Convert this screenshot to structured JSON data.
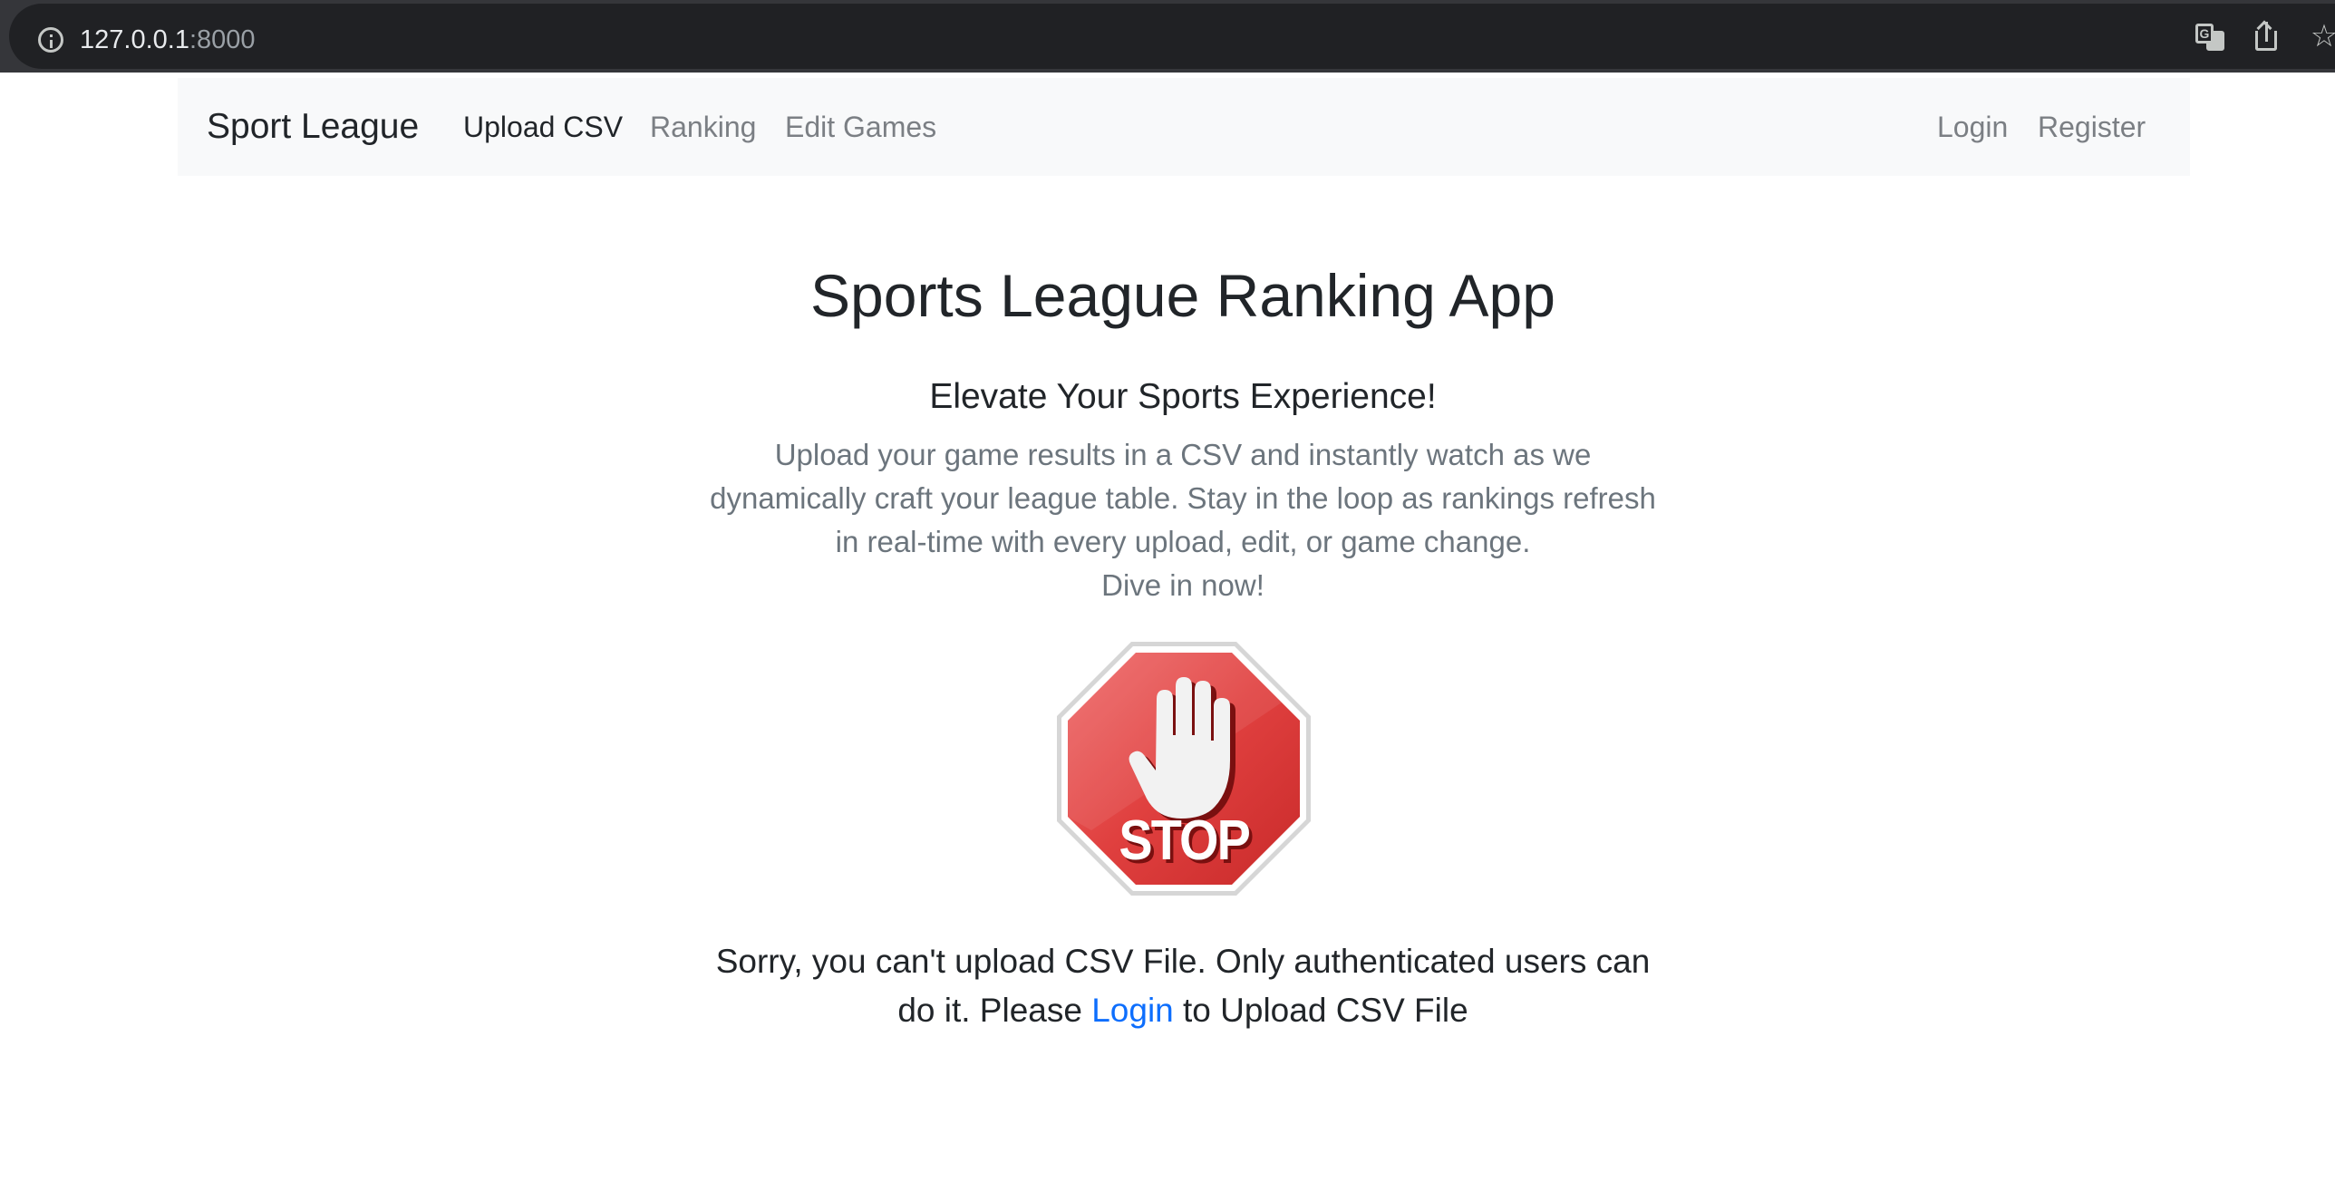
{
  "browser": {
    "url_host": "127.0.0.1",
    "url_port": ":8000",
    "icons": [
      "info-icon",
      "translate-icon",
      "share-icon",
      "star-icon"
    ]
  },
  "navbar": {
    "brand": "Sport League",
    "links": {
      "upload": "Upload CSV",
      "ranking": "Ranking",
      "edit": "Edit Games",
      "login": "Login",
      "register": "Register"
    },
    "active": "upload"
  },
  "main": {
    "title": "Sports League Ranking App",
    "subtitle": "Elevate Your Sports Experience!",
    "lead": "Upload your game results in a CSV and instantly watch as we dynamically craft your league table. Stay in the loop as rankings refresh in real-time with every upload, edit, or game change.",
    "cta": "Dive in now!",
    "stop_image": {
      "icon": "stop-sign-icon",
      "text": "STOP"
    },
    "notice": {
      "before": "Sorry, you can't upload CSV File. Only authenticated users can do it. Please ",
      "link": "Login",
      "after": " to Upload CSV File"
    }
  },
  "colors": {
    "link": "#0d6efd",
    "muted": "#6c757d",
    "text": "#212529",
    "navbar_bg": "#f8f9fa",
    "stop_red": "#d83434"
  }
}
